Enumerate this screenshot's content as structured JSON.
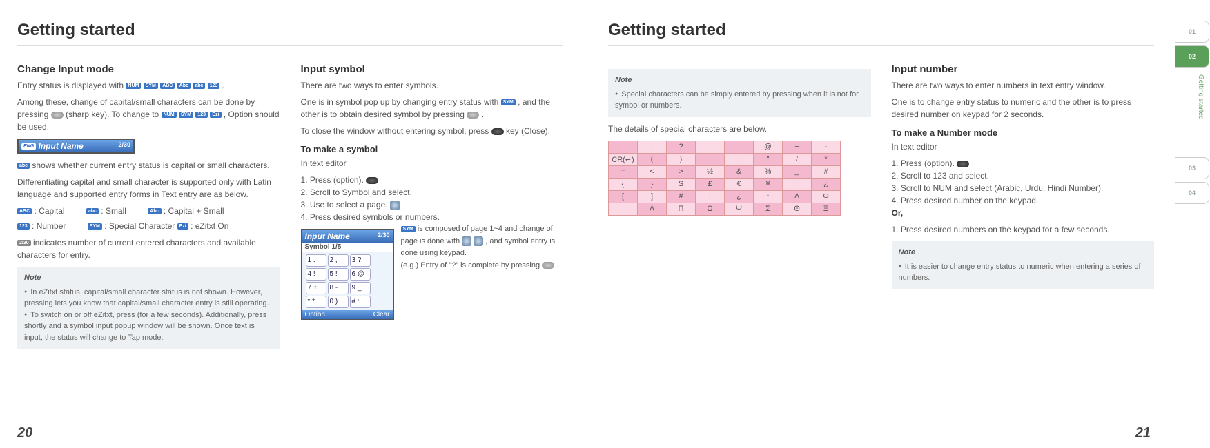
{
  "left": {
    "heading": "Getting started",
    "col1": {
      "h2": "Change Input mode",
      "p1_a": "Entry status is displayed with ",
      "p1_b": ".",
      "p2": "Among these, change of capital/small characters can be done by pressing ",
      "p2_mid": " (sharp key). To change to ",
      "p2_end": ", Option should be used.",
      "badges_row1": [
        "NUM",
        "SYM",
        "ABC",
        "Abc",
        "abc",
        "123"
      ],
      "lcd_title": "Input Name",
      "lcd_count": "2/30",
      "p3": " shows whether current entry status is capital or small characters.",
      "p4": "Differentiating capital and small character is supported only with Latin language and supported entry forms in Text entry are as below.",
      "legend": [
        {
          "b": "ABC",
          "t": " : Capital"
        },
        {
          "b": "abc",
          "t": " : Small"
        },
        {
          "b": "Abc",
          "t": " : Capital + Small"
        },
        {
          "b": "123",
          "t": " : Number"
        },
        {
          "b": "SYM",
          "t": " : Special Character"
        },
        {
          "b": "Ezi",
          "t": " : eZitxt On"
        }
      ],
      "p5": " indicates number of current entered characters and available characters for entry.",
      "note_label": "Note",
      "note_items": [
        "In eZitxt status, capital/small character status is not shown. However, pressing  lets you know that capital/small character entry is still operating.",
        "To switch on or off eZitxt, press  (for a few seconds). Additionally, press  shortly and a symbol input popup window will be shown. Once text is input, the status will change to Tap mode."
      ]
    },
    "col2": {
      "h2": "Input symbol",
      "p1": "There are two ways to enter symbols.",
      "p2_a": "One is in symbol pop up by changing entry status with ",
      "p2_b": ", and the other is to obtain desired symbol by pressing ",
      "p2_c": ".",
      "p3_a": "To close the window without entering symbol, press ",
      "p3_b": " key (Close).",
      "h3": "To make a symbol",
      "sub": "In text editor",
      "steps": [
        "1. Press (option).",
        "2. Scroll to Symbol and select.",
        "3. Use  to select a page.",
        "4. Press desired symbols or numbers."
      ],
      "lcd": {
        "title": "Input Name",
        "count": "2/30",
        "sub": "Symbol   1/5",
        "rows": [
          [
            "1 .",
            "2 ,",
            "3 ?"
          ],
          [
            "4 !",
            "5 !",
            "6 @"
          ],
          [
            "7 +",
            "8 -",
            "9 _"
          ],
          [
            "* *",
            "0 )",
            "# :"
          ]
        ],
        "foot_l": "Option",
        "foot_r": "Clear"
      },
      "side_a": " is composed of page 1~4 and change of page is done with ",
      "side_b": ", and symbol entry is done using keypad.",
      "side_c": "(e.g.) Entry of \"?\" is complete by pressing ",
      "side_d": "."
    },
    "page_num": "20"
  },
  "right": {
    "heading": "Getting started",
    "col1": {
      "note_label": "Note",
      "note_text": "Special characters can be simply entered by pressing  when it is not for symbol or numbers.",
      "p1": "The details of special characters are below.",
      "table": [
        [
          ".",
          ",",
          "?",
          "'",
          "!",
          "@",
          "+",
          "-"
        ],
        [
          "CR(↵)",
          "(",
          ")",
          ":",
          ";",
          "\"",
          "/",
          "*"
        ],
        [
          "=",
          "<",
          ">",
          "½",
          "&",
          "%",
          "_",
          "#"
        ],
        [
          "{",
          "}",
          "$",
          "£",
          "€",
          "¥",
          "¡",
          "¿"
        ],
        [
          "[",
          "]",
          "#",
          "¡",
          "¿",
          "↑",
          "Δ",
          "Φ"
        ],
        [
          "|",
          "Λ",
          "Π",
          "Ω",
          "Ψ",
          "Σ",
          "Θ",
          "Ξ"
        ]
      ]
    },
    "col2": {
      "h2": "Input number",
      "p1": "There are two ways to enter numbers in text entry window.",
      "p2": "One is to change entry status to numeric and the other is to press desired number on keypad for 2 seconds.",
      "h3": "To make a Number mode",
      "sub": "In text editor",
      "steps": [
        "1. Press (option).",
        "2. Scroll to 123 and select.",
        "3. Scroll to NUM and select (Arabic, Urdu, Hindi Number).",
        "4. Press desired number on the keypad."
      ],
      "or": "Or,",
      "alt": "1. Press desired numbers on the keypad for a few seconds.",
      "note_label": "Note",
      "note_text": "It is easier to change entry status to numeric when entering a series of numbers."
    },
    "page_num": "21",
    "chapter_label": "Getting started",
    "tabs": [
      "01",
      "02",
      "03",
      "04"
    ]
  }
}
